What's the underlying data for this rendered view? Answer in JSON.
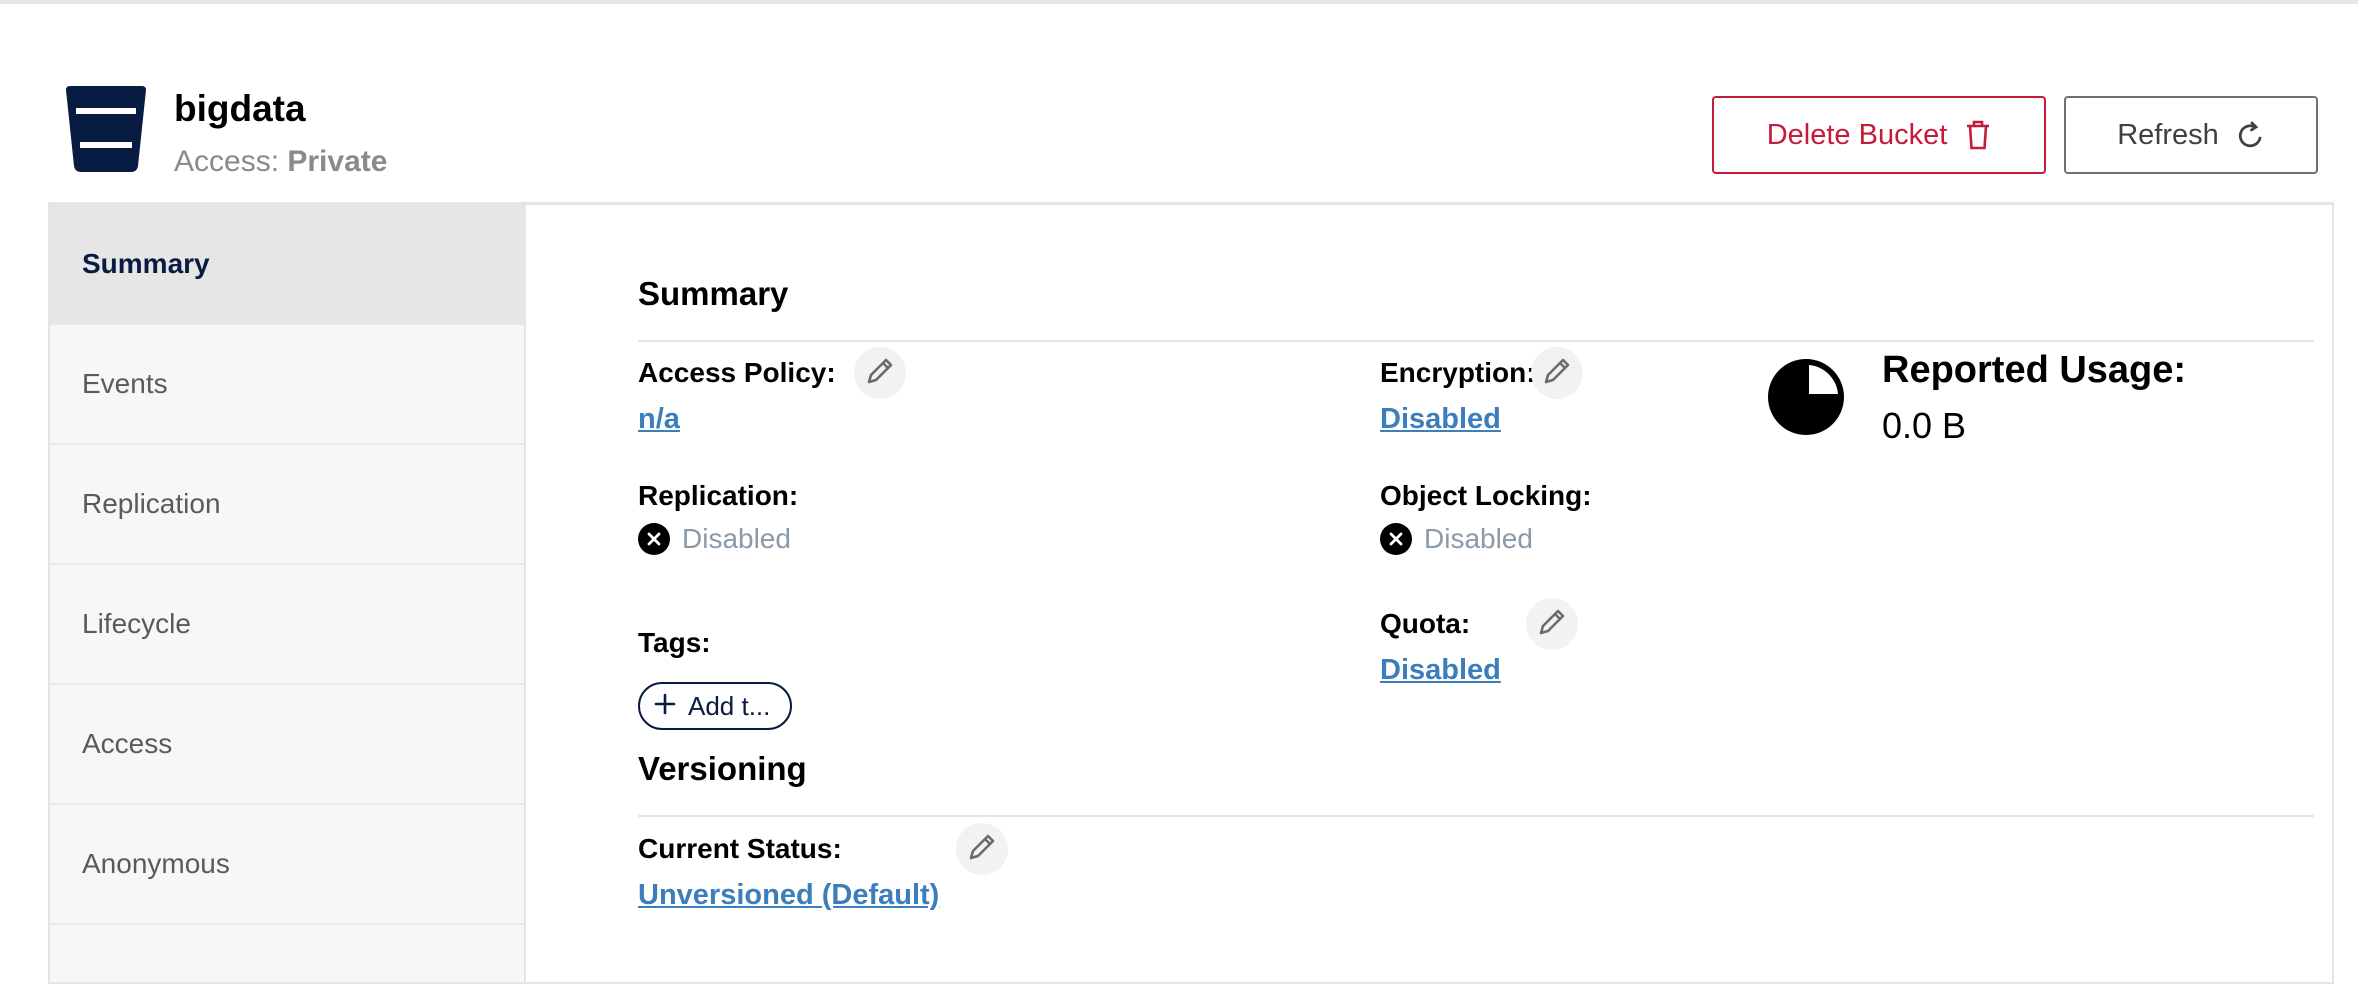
{
  "header": {
    "bucket_name": "bigdata",
    "access_prefix": "Access: ",
    "access_value": "Private",
    "delete_label": "Delete Bucket",
    "refresh_label": "Refresh"
  },
  "sidebar": {
    "items": [
      {
        "label": "Summary",
        "active": true
      },
      {
        "label": "Events"
      },
      {
        "label": "Replication"
      },
      {
        "label": "Lifecycle"
      },
      {
        "label": "Access"
      },
      {
        "label": "Anonymous"
      }
    ]
  },
  "summary": {
    "title": "Summary",
    "access_policy_label": "Access Policy:",
    "access_policy_value": "n/a",
    "encryption_label": "Encryption:",
    "encryption_value": "Disabled",
    "replication_label": "Replication:",
    "replication_value": "Disabled",
    "object_locking_label": "Object Locking:",
    "object_locking_value": "Disabled",
    "tags_label": "Tags:",
    "add_tag_label": "Add t...",
    "quota_label": "Quota:",
    "quota_value": "Disabled",
    "usage_title": "Reported Usage:",
    "usage_value": "0.0 B"
  },
  "versioning": {
    "title": "Versioning",
    "current_status_label": "Current Status:",
    "current_status_value": "Unversioned (Default)"
  },
  "colors": {
    "brand_navy": "#081c42",
    "danger": "#c51b3b",
    "link": "#3c7dbb"
  },
  "icons": [
    "bucket-icon",
    "trash-icon",
    "refresh-icon",
    "pencil-icon",
    "x-circle-icon",
    "plus-icon",
    "pie-chart-icon"
  ]
}
